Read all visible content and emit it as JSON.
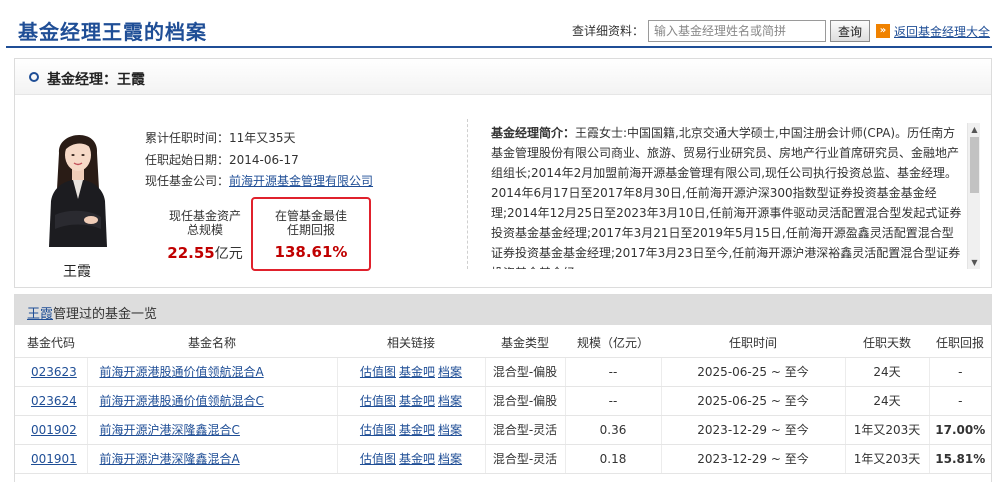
{
  "header": {
    "title": "基金经理王霞的档案",
    "search_label": "查详细资料：",
    "search_placeholder": "输入基金经理姓名或简拼",
    "search_value": "",
    "search_button": "查询",
    "return_icon": "»",
    "return_link": "返回基金经理大全"
  },
  "profile": {
    "heading": "基金经理：王霞",
    "name": "王霞",
    "tenure_label": "累计任职时间：",
    "tenure_value": "11年又35天",
    "start_label": "任职起始日期：",
    "start_value": "2014-06-17",
    "company_label": "现任基金公司：",
    "company_value": "前海开源基金管理有限公司",
    "assets_label_1": "现任基金资产",
    "assets_label_2": "总规模",
    "assets_value": "22.55",
    "assets_unit": "亿元",
    "return_label_1": "在管基金最佳",
    "return_label_2": "任期回报",
    "return_value": "138.61%",
    "bio_title": "基金经理简介：",
    "bio_text": "王霞女士:中国国籍,北京交通大学硕士,中国注册会计师(CPA)。历任南方基金管理股份有限公司商业、旅游、贸易行业研究员、房地产行业首席研究员、金融地产组组长;2014年2月加盟前海开源基金管理有限公司,现任公司执行投资总监、基金经理。2014年6月17日至2017年8月30日,任前海开源沪深300指数型证券投资基金基金经理;2014年12月25日至2023年3月10日,任前海开源事件驱动灵活配置混合型发起式证券投资基金基金经理;2017年3月21日至2019年5月15日,任前海开源盈鑫灵活配置混合型证券投资基金基金经理;2017年3月23日至今,任前海开源沪港深裕鑫灵活配置混合型证券投资基金基金经"
  },
  "funds": {
    "title_link": "王霞",
    "title_suffix": "管理过的基金一览",
    "columns": [
      "基金代码",
      "基金名称",
      "相关链接",
      "基金类型",
      "规模（亿元）",
      "任职时间",
      "任职天数",
      "任职回报"
    ],
    "links": [
      "估值图",
      "基金吧",
      "档案"
    ],
    "rows": [
      {
        "code": "023623",
        "name": "前海开源港股通价值领航混合A",
        "type": "混合型-偏股",
        "scale": "--",
        "period": "2025-06-25 ~ 至今",
        "days": "24天",
        "ret": "-"
      },
      {
        "code": "023624",
        "name": "前海开源港股通价值领航混合C",
        "type": "混合型-偏股",
        "scale": "--",
        "period": "2025-06-25 ~ 至今",
        "days": "24天",
        "ret": "-"
      },
      {
        "code": "001902",
        "name": "前海开源沪港深隆鑫混合C",
        "type": "混合型-灵活",
        "scale": "0.36",
        "period": "2023-12-29 ~ 至今",
        "days": "1年又203天",
        "ret": "17.00%"
      },
      {
        "code": "001901",
        "name": "前海开源沪港深隆鑫混合A",
        "type": "混合型-灵活",
        "scale": "0.18",
        "period": "2023-12-29 ~ 至今",
        "days": "1年又203天",
        "ret": "15.81%"
      }
    ]
  },
  "icons": {
    "bullet": "circle-bullet-icon",
    "return": "double-chevron-right-icon"
  },
  "colors": {
    "title_blue": "#1f4e96",
    "highlight_red": "#e0212c",
    "value_red": "#c00000",
    "accent_orange": "#f08200"
  }
}
